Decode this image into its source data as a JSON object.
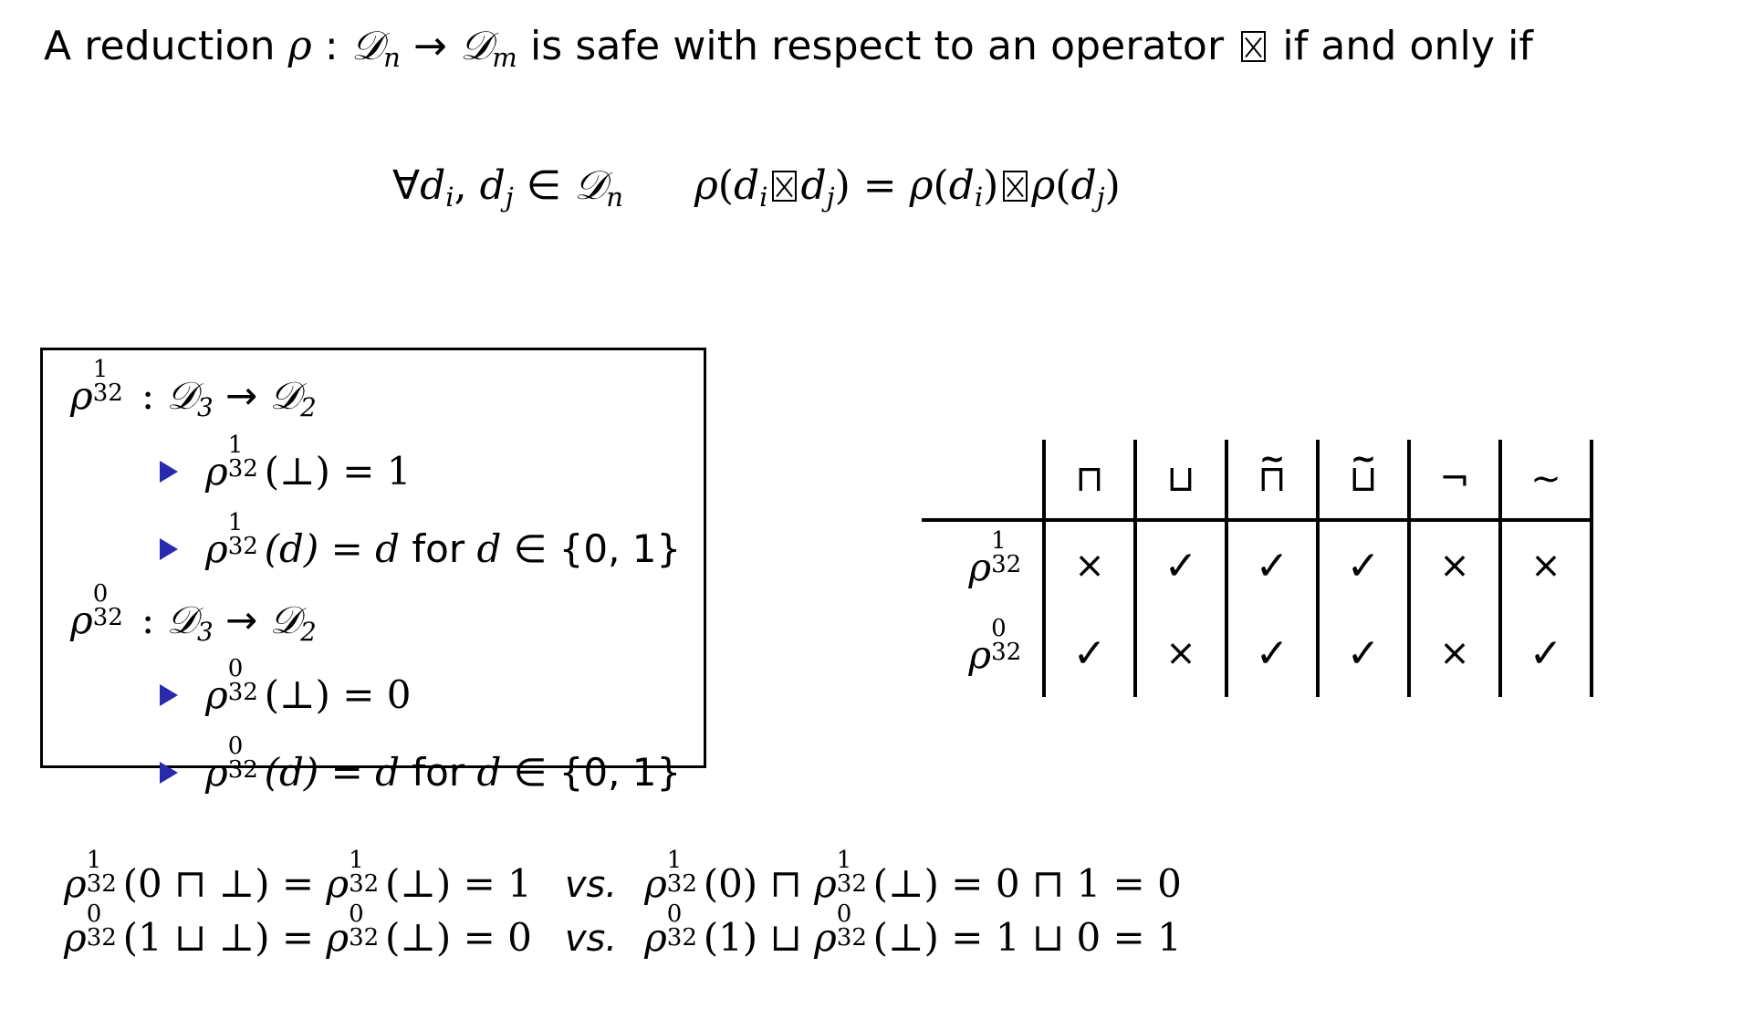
{
  "slide": {
    "background_color": "#ffffff",
    "text_color": "#000000",
    "bullet_color": "#2a2aaf"
  },
  "statement": {
    "part_1": "A reduction ",
    "rho": "ρ",
    "colon": " : ",
    "domain_cal": "𝒟",
    "domain_sub_n": "n",
    "arrow": " → ",
    "codomain_cal": "𝒟",
    "codomain_sub_m": "m",
    "part_2": " is safe with respect to an operator ",
    "operator_glyph": "boxed-x",
    "part_3": " if and only if",
    "full_text": "A reduction ρ : 𝒟n → 𝒟m is safe with respect to an operator ⊠ if and only if"
  },
  "formula": {
    "forall": "∀",
    "d_i": "d",
    "sub_i": "i",
    "comma": ", ",
    "d_j": "d",
    "sub_j": "j",
    "in": " ∈ ",
    "domain": "𝒟",
    "domain_sub": "n",
    "rho": "ρ",
    "open": "(",
    "eq": " = ",
    "close": ")",
    "full_text": "∀di, dj ∈ 𝒟n    ρ(di ⊠ dj) = ρ(di) ⊠ ρ(dj)"
  },
  "definition_box": {
    "entries": [
      {
        "kind": "heading",
        "rho": "ρ",
        "sup": "1",
        "sub": "32",
        "rest": " : ",
        "dom": "𝒟",
        "dom_sub": "3",
        "arrow": " → ",
        "cod": "𝒟",
        "cod_sub": "2",
        "text": "ρ¹₃₂ : 𝒟₃ → 𝒟₂"
      },
      {
        "kind": "bullet",
        "rho": "ρ",
        "sup": "1",
        "sub": "32",
        "body_1": "(⊥) = 1",
        "text": "ρ¹₃₂(⊥) = 1"
      },
      {
        "kind": "bullet",
        "rho": "ρ",
        "sup": "1",
        "sub": "32",
        "body_1": "(d) = d",
        "body_for": " for ",
        "body_2": "d",
        "body_in": " ∈ {0, 1}",
        "text": "ρ¹₃₂(d) = d for d ∈ {0,1}"
      },
      {
        "kind": "heading",
        "rho": "ρ",
        "sup": "0",
        "sub": "32",
        "rest": " : ",
        "dom": "𝒟",
        "dom_sub": "3",
        "arrow": " → ",
        "cod": "𝒟",
        "cod_sub": "2",
        "text": "ρ⁰₃₂ : 𝒟₃ → 𝒟₂"
      },
      {
        "kind": "bullet",
        "rho": "ρ",
        "sup": "0",
        "sub": "32",
        "body_1": "(⊥) = 0",
        "text": "ρ⁰₃₂(⊥) = 0"
      },
      {
        "kind": "bullet",
        "rho": "ρ",
        "sup": "0",
        "sub": "32",
        "body_1": "(d) = d",
        "body_for": " for ",
        "body_2": "d",
        "body_in": " ∈ {0, 1}",
        "text": "ρ⁰₃₂(d) = d for d ∈ {0,1}"
      }
    ]
  },
  "safety_table": {
    "columns": [
      {
        "id": "sqcap",
        "glyph": "⊓",
        "accent": "",
        "label": "⊓"
      },
      {
        "id": "sqcup",
        "glyph": "⊔",
        "accent": "",
        "label": "⊔"
      },
      {
        "id": "sqcap-tilde",
        "glyph": "⊓",
        "accent": "~",
        "label": "⊓̃"
      },
      {
        "id": "sqcup-tilde",
        "glyph": "⊔",
        "accent": "~",
        "label": "⊔̃"
      },
      {
        "id": "negation",
        "glyph": "¬",
        "accent": "",
        "label": "¬"
      },
      {
        "id": "tilde",
        "glyph": "∼",
        "accent": "",
        "label": "∼"
      }
    ],
    "rows": [
      {
        "label_rho": "ρ",
        "label_sup": "1",
        "label_sub": "32",
        "label_text": "ρ¹₃₂",
        "cells": [
          "×",
          "✓",
          "✓",
          "✓",
          "×",
          "×"
        ]
      },
      {
        "label_rho": "ρ",
        "label_sup": "0",
        "label_sub": "32",
        "label_text": "ρ⁰₃₂",
        "cells": [
          "✓",
          "×",
          "✓",
          "✓",
          "×",
          "✓"
        ]
      }
    ]
  },
  "comparison": {
    "rows": [
      {
        "left_rho": "ρ",
        "left_sup": "1",
        "left_sub": "32",
        "left_arg": "(0 ⊓ ⊥) = ",
        "left_rho2": "ρ",
        "left_sup2": "1",
        "left_sub2": "32",
        "left_tail": "(⊥) = 1",
        "vs": "vs.",
        "right_rho": "ρ",
        "right_sup": "1",
        "right_sub": "32",
        "right_arg": "(0) ⊓ ",
        "right_rho2": "ρ",
        "right_sup2": "1",
        "right_sub2": "32",
        "right_tail": "(⊥) = 0 ⊓ 1 = 0",
        "left_text": "ρ¹₃₂(0 ⊓ ⊥) = ρ¹₃₂(⊥) = 1",
        "right_text": "ρ¹₃₂(0) ⊓ ρ¹₃₂(⊥) = 0 ⊓ 1 = 0"
      },
      {
        "left_rho": "ρ",
        "left_sup": "0",
        "left_sub": "32",
        "left_arg": "(1 ⊔ ⊥) = ",
        "left_rho2": "ρ",
        "left_sup2": "0",
        "left_sub2": "32",
        "left_tail": "(⊥) = 0",
        "vs": "vs.",
        "right_rho": "ρ",
        "right_sup": "0",
        "right_sub": "32",
        "right_arg": "(1) ⊔ ",
        "right_rho2": "ρ",
        "right_sup2": "0",
        "right_sub2": "32",
        "right_tail": "(⊥) = 1 ⊔ 0 = 1",
        "left_text": "ρ⁰₃₂(1 ⊔ ⊥) = ρ⁰₃₂(⊥) = 0",
        "right_text": "ρ⁰₃₂(1) ⊔ ρ⁰₃₂(⊥) = 1 ⊔ 0 = 1"
      }
    ]
  }
}
